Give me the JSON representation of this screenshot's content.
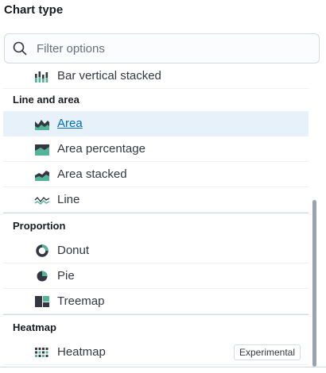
{
  "header": {
    "title": "Chart type"
  },
  "search": {
    "placeholder": "Filter options"
  },
  "rows": [
    {
      "label": "Bar vertical stacked",
      "icon": "bar-vertical-stacked-icon"
    },
    {
      "label": "Area",
      "icon": "area-icon",
      "selected": true
    },
    {
      "label": "Area percentage",
      "icon": "area-percentage-icon"
    },
    {
      "label": "Area stacked",
      "icon": "area-stacked-icon"
    },
    {
      "label": "Line",
      "icon": "line-icon"
    },
    {
      "label": "Donut",
      "icon": "donut-icon"
    },
    {
      "label": "Pie",
      "icon": "pie-icon"
    },
    {
      "label": "Treemap",
      "icon": "treemap-icon"
    },
    {
      "label": "Heatmap",
      "icon": "heatmap-icon",
      "badge": "Experimental"
    }
  ],
  "groups": [
    {
      "label": "Line and area"
    },
    {
      "label": "Proportion"
    },
    {
      "label": "Heatmap"
    }
  ],
  "colors": {
    "accent": "#006bb8",
    "icon_teal": "#54b399",
    "icon_dark": "#343741",
    "selected_bg": "#e6f1fa"
  }
}
